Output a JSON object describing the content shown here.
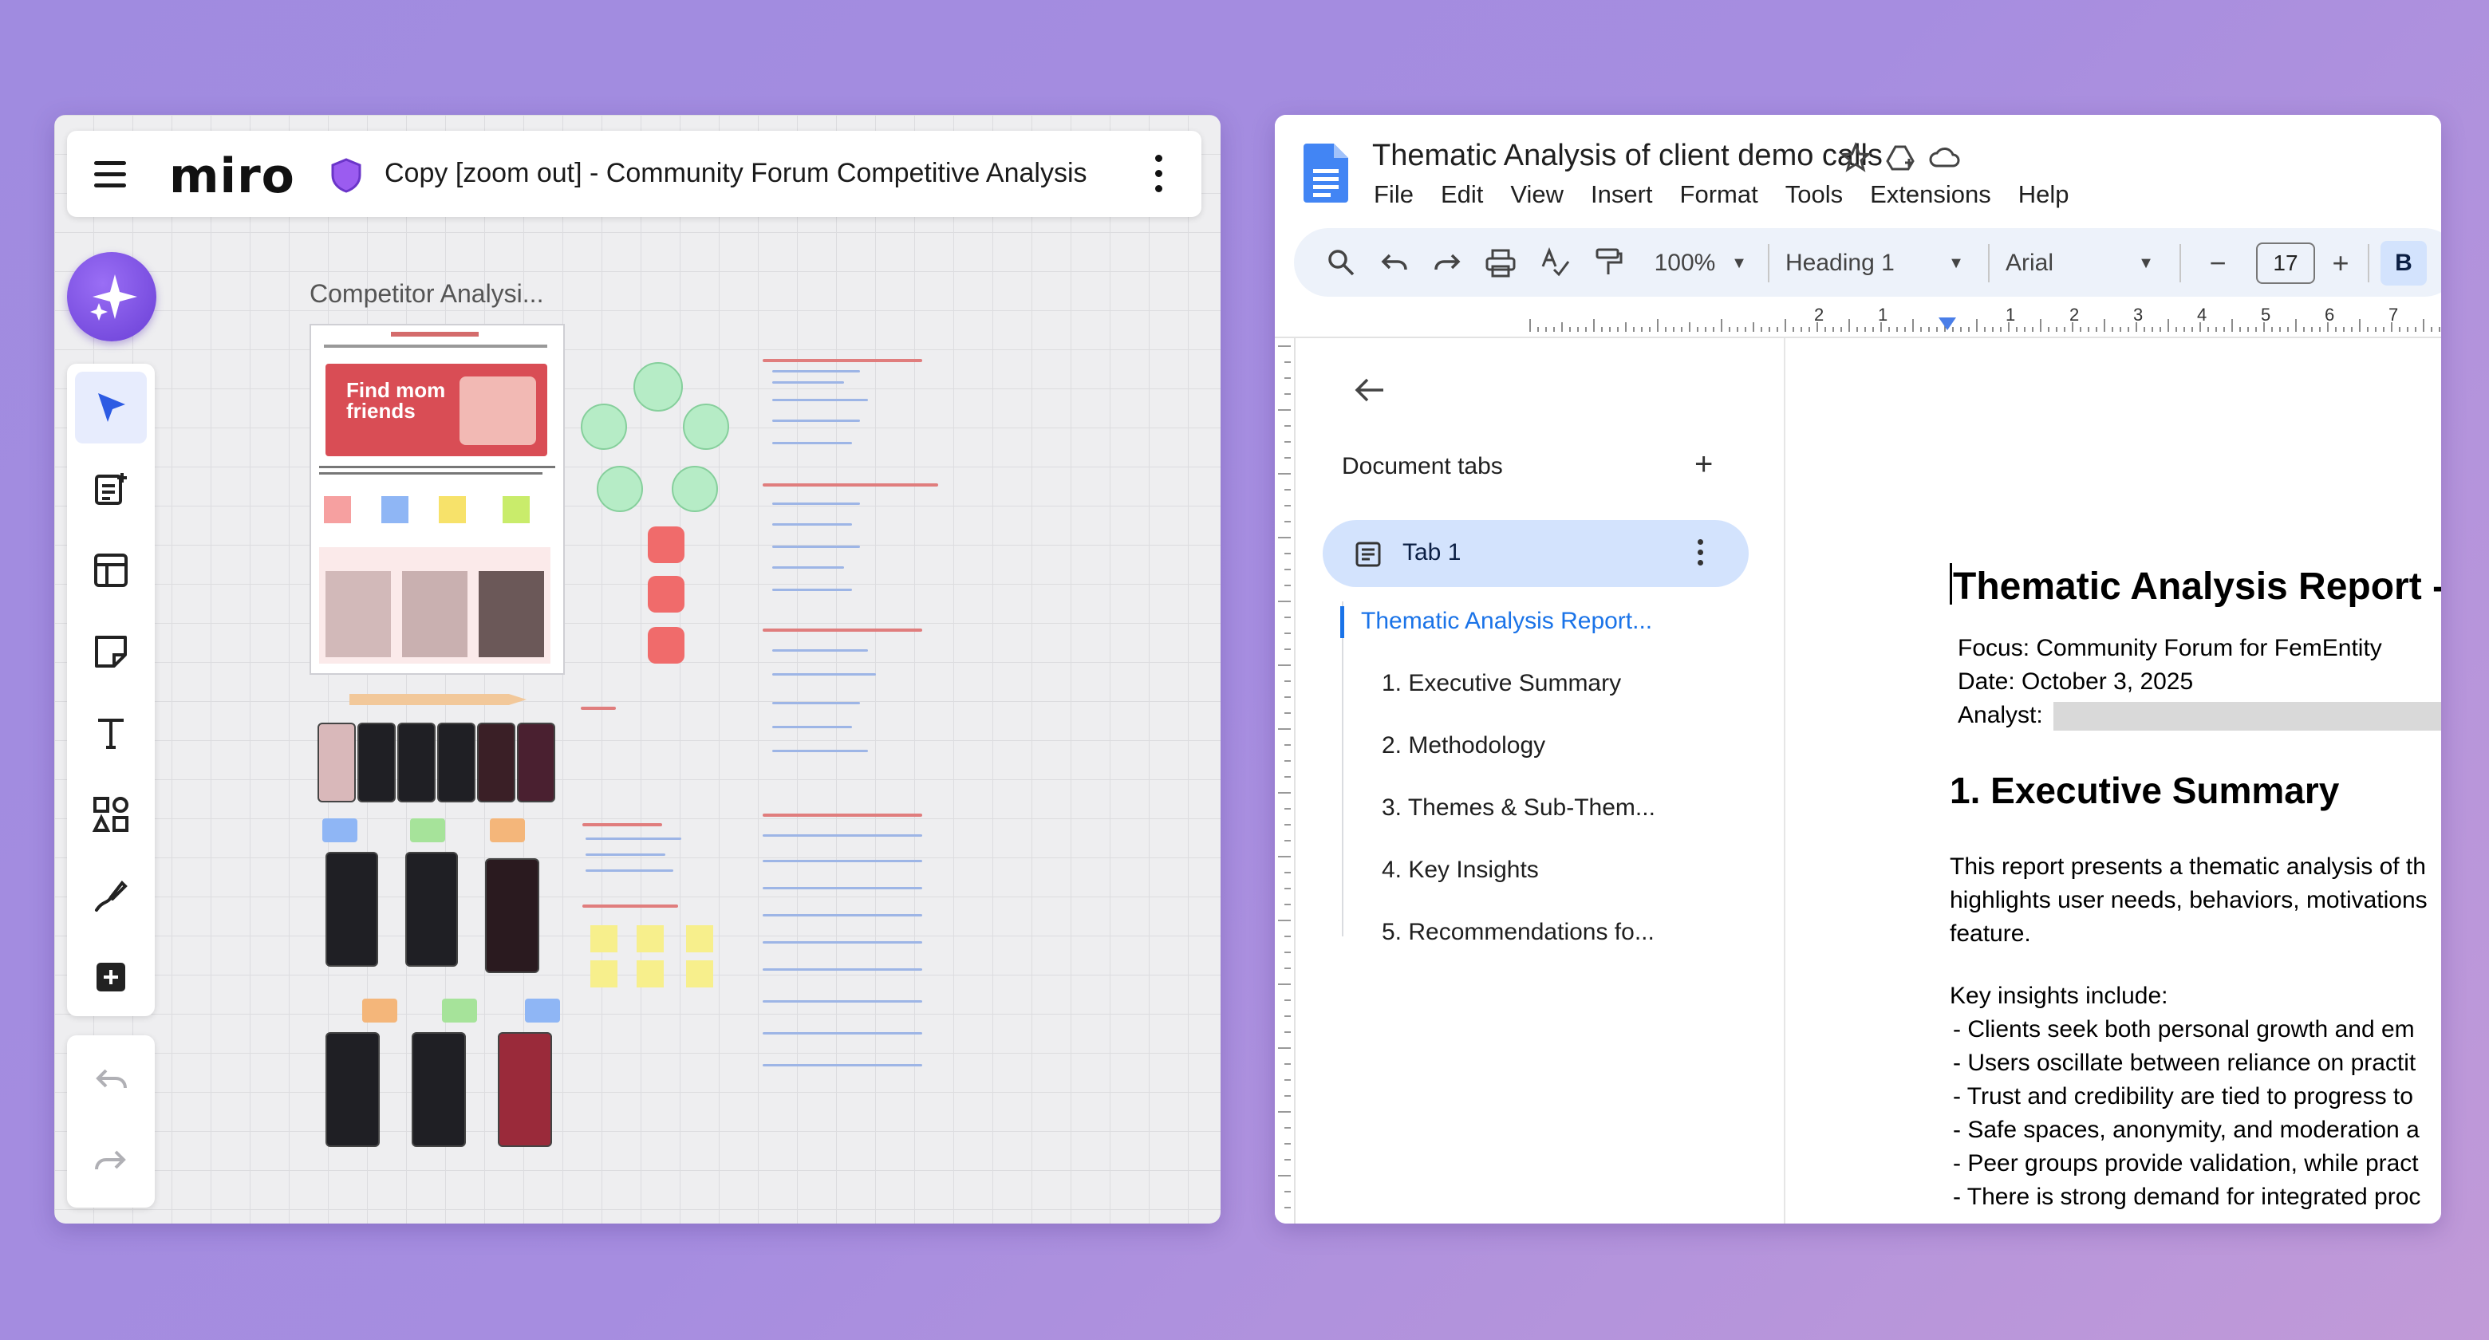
{
  "miro": {
    "logo": "miro",
    "board_title": "Copy [zoom out] - Community Forum Competitive Analysis",
    "frame_label": "Competitor Analysi...",
    "hero_text": "Find mom friends",
    "tools": [
      "select-tool",
      "templates-tool",
      "layout-tool",
      "sticky-note-tool",
      "text-tool",
      "shapes-tool",
      "pen-tool",
      "more-tool"
    ]
  },
  "docs": {
    "title": "Thematic Analysis of client demo calls",
    "menu": [
      "File",
      "Edit",
      "View",
      "Insert",
      "Format",
      "Tools",
      "Extensions",
      "Help"
    ],
    "toolbar": {
      "zoom": "100%",
      "style": "Heading 1",
      "font": "Arial",
      "font_size": "17",
      "bold": "B"
    },
    "sidebar": {
      "heading": "Document tabs",
      "tab_label": "Tab 1",
      "outline": [
        "Thematic Analysis Report...",
        "1. Executive Summary",
        "2. Methodology",
        "3. Themes & Sub-Them...",
        "4. Key Insights",
        "5. Recommendations fo..."
      ]
    },
    "page": {
      "title": "Thematic Analysis Report -",
      "focus": "Focus: Community Forum for FemEntity",
      "date": "Date: October 3, 2025",
      "analyst": "Analyst:",
      "h1": "1. Executive Summary",
      "para": [
        "This report presents a thematic analysis of th",
        "highlights user needs, behaviors, motivations",
        "feature."
      ],
      "insights_intro": "Key insights include:",
      "bullets": [
        "- Clients seek both personal growth and em",
        "- Users oscillate between reliance on practit",
        "- Trust and credibility are tied to progress to",
        "- Safe spaces, anonymity, and moderation a",
        "- Peer groups provide validation, while pract",
        "- There is strong demand for integrated proc"
      ]
    },
    "ruler_numbers": [
      "2",
      "1",
      "1",
      "2",
      "3",
      "4",
      "5",
      "6",
      "7"
    ]
  },
  "colors": {
    "miro_accent": "#6a3fd6",
    "docs_blue": "#1a73e8",
    "tab_bg": "#d3e3fd",
    "background": "#a68de0"
  }
}
